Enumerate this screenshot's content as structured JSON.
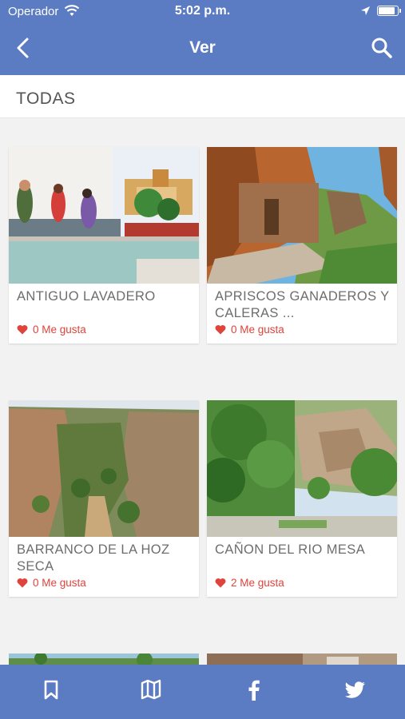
{
  "status_bar": {
    "carrier": "Operador",
    "time": "5:02 p.m.",
    "battery_level": 0.9
  },
  "nav": {
    "title": "Ver",
    "back_icon": "chevron-left-icon",
    "search_icon": "search-icon"
  },
  "filter": {
    "label": "TODAS"
  },
  "places": [
    {
      "name": "ANTIGUO LAVADERO",
      "likes": "0 Me gusta"
    },
    {
      "name": "APRISCOS GANADEROS Y CALERAS ...",
      "likes": "0 Me gusta"
    },
    {
      "name": "BARRANCO DE LA HOZ SECA",
      "likes": "0 Me gusta"
    },
    {
      "name": "CAÑON DEL RIO MESA",
      "likes": "2 Me gusta"
    }
  ],
  "tab_bar": {
    "items": [
      "bookmark-icon",
      "map-icon",
      "facebook-icon",
      "twitter-icon"
    ]
  },
  "colors": {
    "primary": "#5b7bc3",
    "like": "#e0433b",
    "text_muted": "#6d6d6d"
  }
}
